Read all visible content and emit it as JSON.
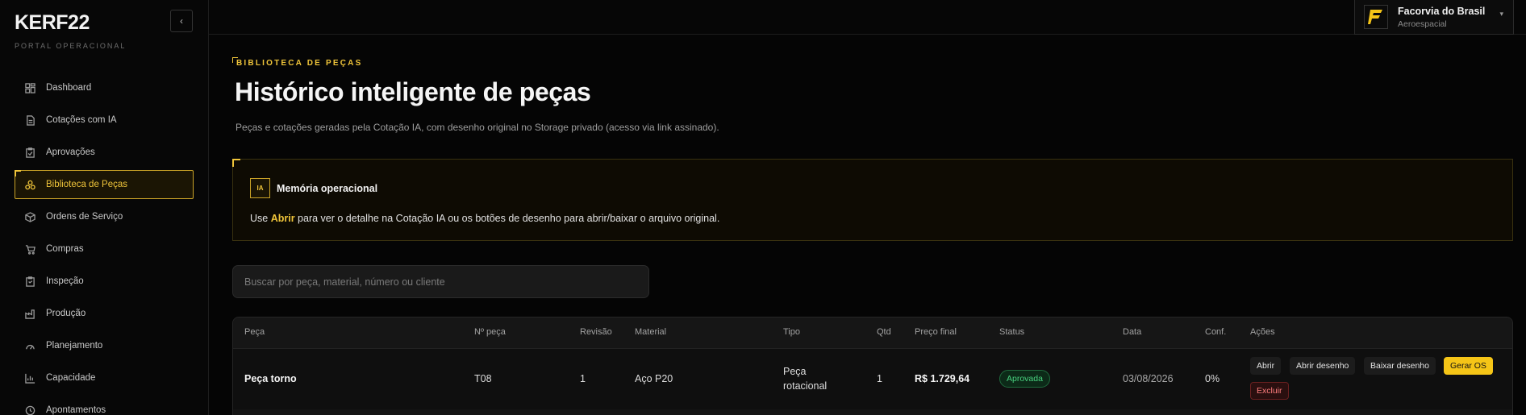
{
  "sidebar": {
    "logo": "KERF22",
    "subtitle": "PORTAL OPERACIONAL",
    "collapse_icon": "chevron-left-icon",
    "items": [
      {
        "label": "Dashboard",
        "icon": "dashboard-icon"
      },
      {
        "label": "Cotações com IA",
        "icon": "document-icon"
      },
      {
        "label": "Aprovações",
        "icon": "clipboard-check-icon"
      },
      {
        "label": "Biblioteca de Peças",
        "icon": "parts-library-icon",
        "active": true
      },
      {
        "label": "Ordens de Serviço",
        "icon": "box-icon"
      },
      {
        "label": "Compras",
        "icon": "cart-icon"
      },
      {
        "label": "Inspeção",
        "icon": "clipboard-icon"
      },
      {
        "label": "Produção",
        "icon": "factory-icon"
      },
      {
        "label": "Planejamento",
        "icon": "gauge-icon"
      },
      {
        "label": "Capacidade",
        "icon": "bar-chart-icon"
      },
      {
        "label": "Apontamentos",
        "icon": "clock-icon"
      }
    ]
  },
  "company": {
    "name": "Facorvia do Brasil",
    "sector": "Aeroespacial",
    "logo_icon": "company-logo-icon",
    "caret": "▾"
  },
  "main": {
    "eyebrow": "BIBLIOTECA DE PEÇAS",
    "title": "Histórico inteligente de peças",
    "description": "Peças e cotações geradas pela Cotação IA, com desenho original no Storage privado (acesso via link assinado).",
    "callout": {
      "badge": "IA",
      "title": "Memória operacional",
      "text_before": "Use ",
      "highlight": "Abrir",
      "text_after": " para ver o detalhe na Cotação IA ou os botões de desenho para abrir/baixar o arquivo original."
    },
    "search": {
      "placeholder": "Buscar por peça, material, número ou cliente",
      "value": ""
    },
    "table": {
      "headers": [
        "Peça",
        "Nº peça",
        "Revisão",
        "Material",
        "Tipo",
        "Qtd",
        "Preço final",
        "Status",
        "Data",
        "Conf.",
        "Ações"
      ],
      "rows": [
        {
          "peca": "Peça torno",
          "numero": "T08",
          "revisao": "1",
          "material": "Aço P20",
          "tipo_line1": "Peça",
          "tipo_line2": "rotacional",
          "qtd": "1",
          "preco": "R$ 1.729,64",
          "status": "Aprovada",
          "data": "03/08/2026",
          "conf": "0%",
          "actions": {
            "abrir": "Abrir",
            "abrir_desenho": "Abrir desenho",
            "baixar_desenho": "Baixar desenho",
            "gerar_os": "Gerar OS",
            "excluir": "Excluir"
          }
        }
      ]
    }
  },
  "colors": {
    "accent": "#f0c53a",
    "success": "#49d17f",
    "danger": "#ff7d7d"
  }
}
